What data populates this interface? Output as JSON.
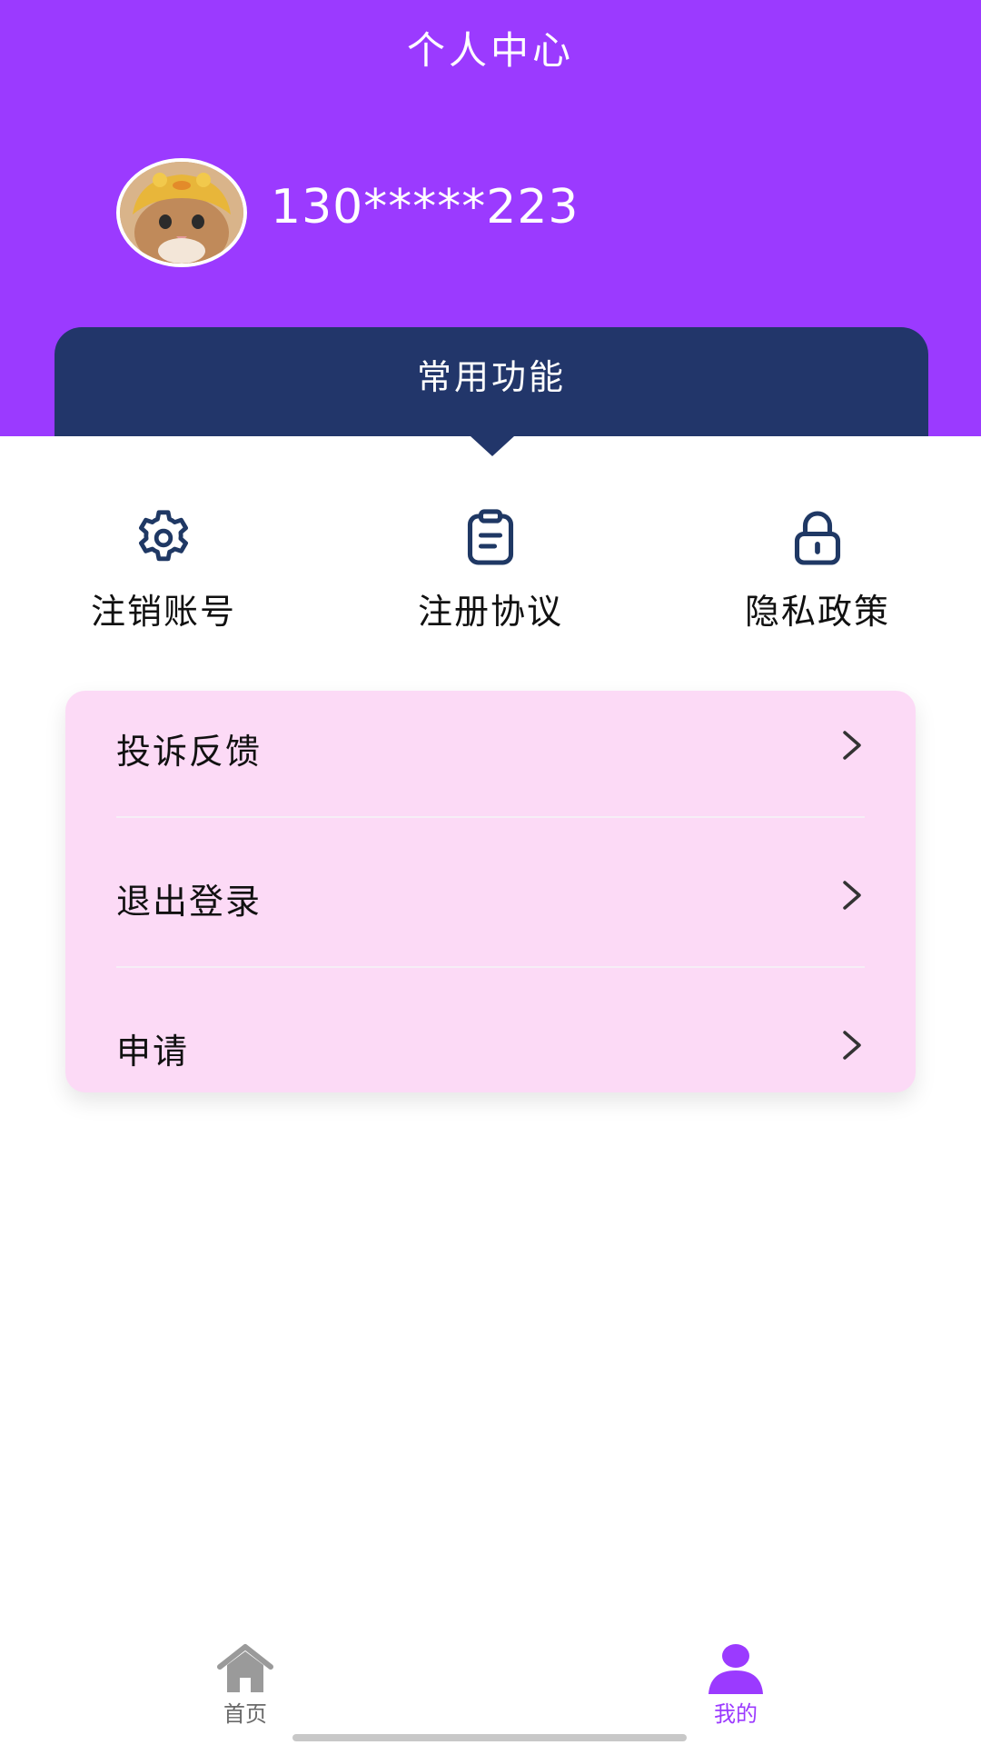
{
  "header": {
    "title": "个人中心",
    "background_color": "#9b3aff",
    "avatar_icon": "cat-avatar",
    "phone": "130*****223"
  },
  "common_functions": {
    "title": "常用功能",
    "tab_color": "#22366a",
    "items": [
      {
        "label": "注销账号",
        "icon": "gear-icon"
      },
      {
        "label": "注册协议",
        "icon": "clipboard-icon"
      },
      {
        "label": "隐私政策",
        "icon": "lock-icon"
      }
    ]
  },
  "menu": {
    "background_color": "#fcdaf6",
    "items": [
      {
        "label": "投诉反馈",
        "icon": "chevron-right-icon"
      },
      {
        "label": "退出登录",
        "icon": "chevron-right-icon"
      },
      {
        "label": "申请",
        "icon": "chevron-right-icon"
      }
    ]
  },
  "bottom_nav": {
    "active_color": "#9b3aff",
    "inactive_color": "#9a9a9a",
    "items": [
      {
        "label": "首页",
        "icon": "home-icon",
        "active": false
      },
      {
        "label": "我的",
        "icon": "user-icon",
        "active": true
      }
    ]
  }
}
